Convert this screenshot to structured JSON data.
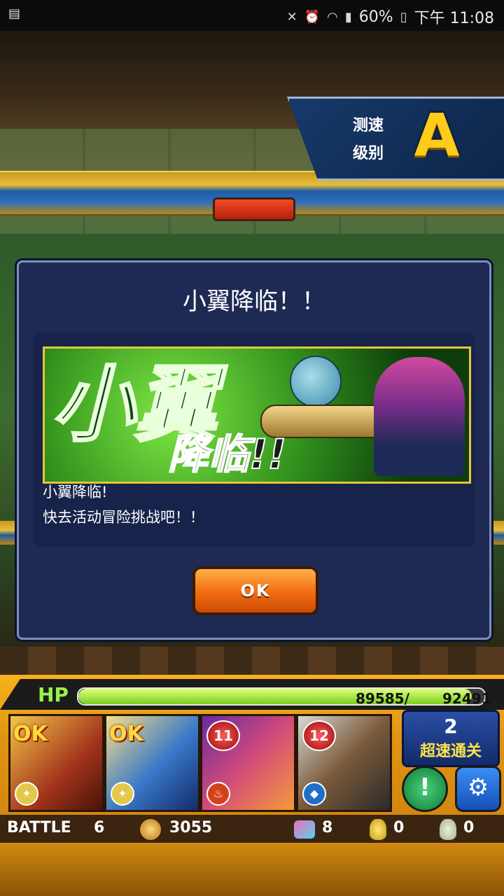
{
  "status_bar": {
    "left_icon": "notification-icon",
    "battery": "60%",
    "time": "下午 11:08",
    "icons": [
      "mute-icon",
      "alarm-icon",
      "wifi-icon",
      "signal-icon",
      "battery-icon"
    ]
  },
  "speed_rank": {
    "label_line1": "测速",
    "label_line2": "级别",
    "grade": "A"
  },
  "dialog": {
    "title": "小翼降临！！",
    "banner_title": "小翼",
    "banner_subtitle": "降临!!",
    "message_line1": "小翼降临!",
    "message_line2": "快去活动冒险挑战吧！！",
    "ok_label": "OK"
  },
  "hud": {
    "hp_label": "HP",
    "hp_current": "89585/",
    "hp_max": "92491",
    "hp_fraction": 0.9686,
    "team": [
      {
        "badge": "OK",
        "element": "light"
      },
      {
        "badge": "OK",
        "element": "light"
      },
      {
        "badge": "11",
        "element": "fire"
      },
      {
        "badge": "12",
        "element": "water"
      }
    ],
    "clear_count": "2",
    "clear_label": "超速通关",
    "battle_label": "BATTLE",
    "battle_number": "6",
    "coins": "3055",
    "gems": "8",
    "gold_eggs": "0",
    "eggs": "0"
  },
  "colors": {
    "ok_button": "#f26b10",
    "dialog_bg": "#1e2a54",
    "hp_fill": "#7ccf1f",
    "grade": "#ffcc1a"
  }
}
